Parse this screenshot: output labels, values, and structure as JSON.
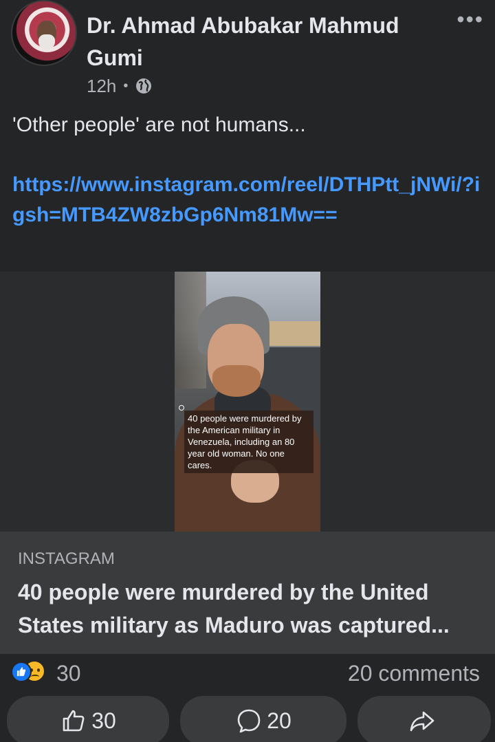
{
  "post": {
    "author": "Dr. Ahmad Abubakar Mahmud Gumi",
    "time": "12h",
    "separator": "•",
    "visibility_icon": "globe-icon",
    "more_icon": "more-options-icon",
    "text": "'Other people' are not humans...",
    "link_text": "https://www.instagram.com/reel/DTHPtt_jNWi/?igsh=MTB4ZW8zbGp6Nm81Mw=="
  },
  "media": {
    "overlay_caption": "40 people were murdered by the American military in Venezuela, including an 80 year old woman. No one cares."
  },
  "link_preview": {
    "source": "INSTAGRAM",
    "title": "40 people were murdered by the United States military as Maduro was captured..."
  },
  "reactions": {
    "icons": [
      "like-reaction-icon",
      "sad-reaction-icon"
    ],
    "count": "30",
    "comments": "20 comments"
  },
  "actions": {
    "like_count": "30",
    "comment_count": "20",
    "share_icon": "share-icon"
  },
  "colors": {
    "background": "#242526",
    "link": "#4599ff",
    "card": "#3a3b3c",
    "like_blue": "#1877f2",
    "sad_yellow": "#f7b928"
  }
}
